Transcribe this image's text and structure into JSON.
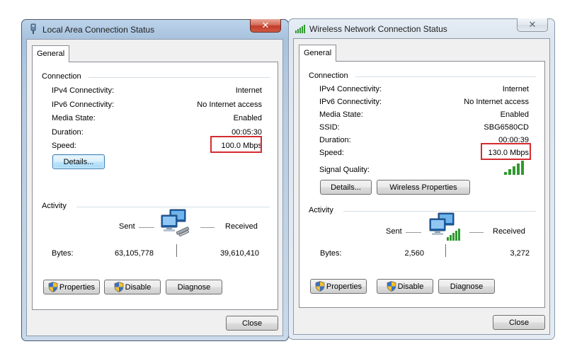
{
  "left_window": {
    "title": "Local Area Connection Status",
    "close_glyph": "✕",
    "tab": "General",
    "connection_heading": "Connection",
    "rows": [
      {
        "label": "IPv4 Connectivity:",
        "value": "Internet"
      },
      {
        "label": "IPv6 Connectivity:",
        "value": "No Internet access"
      },
      {
        "label": "Media State:",
        "value": "Enabled"
      },
      {
        "label": "Duration:",
        "value": "00:05:30"
      },
      {
        "label": "Speed:",
        "value": "100.0 Mbps"
      }
    ],
    "details_button": "Details...",
    "activity_heading": "Activity",
    "sent_label": "Sent",
    "received_label": "Received",
    "bytes_label": "Bytes:",
    "bytes_sent": "63,105,778",
    "bytes_received": "39,610,410",
    "properties_button": "Properties",
    "disable_button": "Disable",
    "diagnose_button": "Diagnose",
    "close_button": "Close",
    "title_icon": "network-cable-icon",
    "activity_icon": "wired-network-computers-icon"
  },
  "right_window": {
    "title": "Wireless Network Connection Status",
    "close_glyph": "✕",
    "tab": "General",
    "connection_heading": "Connection",
    "rows": [
      {
        "label": "IPv4 Connectivity:",
        "value": "Internet"
      },
      {
        "label": "IPv6 Connectivity:",
        "value": "No Internet access"
      },
      {
        "label": "Media State:",
        "value": "Enabled"
      },
      {
        "label": "SSID:",
        "value": "SBG6580CD"
      },
      {
        "label": "Duration:",
        "value": "00:00:39"
      },
      {
        "label": "Speed:",
        "value": "130.0 Mbps"
      }
    ],
    "signal_label": "Signal Quality:",
    "signal_bars_active": 5,
    "signal_bars_total": 5,
    "details_button": "Details...",
    "wireless_properties_button": "Wireless Properties",
    "activity_heading": "Activity",
    "sent_label": "Sent",
    "received_label": "Received",
    "bytes_label": "Bytes:",
    "bytes_sent": "2,560",
    "bytes_received": "3,272",
    "properties_button": "Properties",
    "disable_button": "Disable",
    "diagnose_button": "Diagnose",
    "close_button": "Close",
    "title_icon": "wireless-signal-icon",
    "activity_icon": "wireless-network-computers-icon"
  },
  "colors": {
    "highlight_box": "#d52b30",
    "signal_bar": "#2f9a2f",
    "active_frame": "#a9c3de",
    "inactive_frame": "#dde6ef"
  }
}
